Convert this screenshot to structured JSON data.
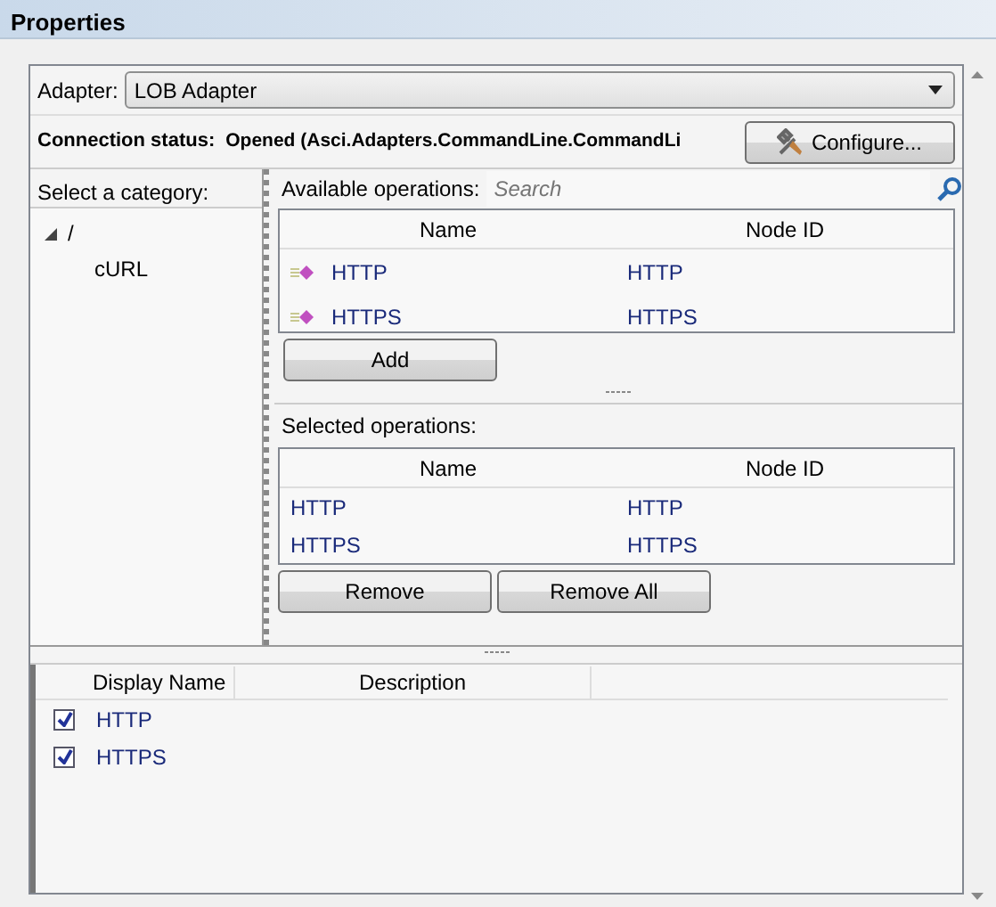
{
  "window": {
    "title": "Properties"
  },
  "adapter": {
    "label": "Adapter:",
    "value": "LOB Adapter"
  },
  "connection": {
    "label": "Connection status:",
    "value": "Opened (Asci.Adapters.CommandLine.CommandLi",
    "button": "Configure..."
  },
  "category": {
    "label": "Select a category:",
    "tree": [
      {
        "label": "/",
        "expanded": true,
        "children": [
          {
            "label": "cURL"
          }
        ]
      }
    ]
  },
  "available": {
    "label": "Available operations:",
    "search_placeholder": "Search",
    "columns": [
      "Name",
      "Node ID"
    ],
    "rows": [
      [
        "HTTP",
        "HTTP"
      ],
      [
        "HTTPS",
        "HTTPS"
      ]
    ],
    "button": "Add"
  },
  "selected_ops": {
    "label": "Selected operations:",
    "columns": [
      "Name",
      "Node ID"
    ],
    "rows": [
      [
        "HTTP",
        "HTTP"
      ],
      [
        "HTTPS",
        "HTTPS"
      ]
    ],
    "buttons": [
      "Remove",
      "Remove All"
    ]
  },
  "grid": {
    "columns": [
      "Display Name",
      "Description"
    ],
    "rows": [
      {
        "name": "HTTP",
        "checked": true
      },
      {
        "name": "HTTPS",
        "checked": true
      }
    ]
  }
}
